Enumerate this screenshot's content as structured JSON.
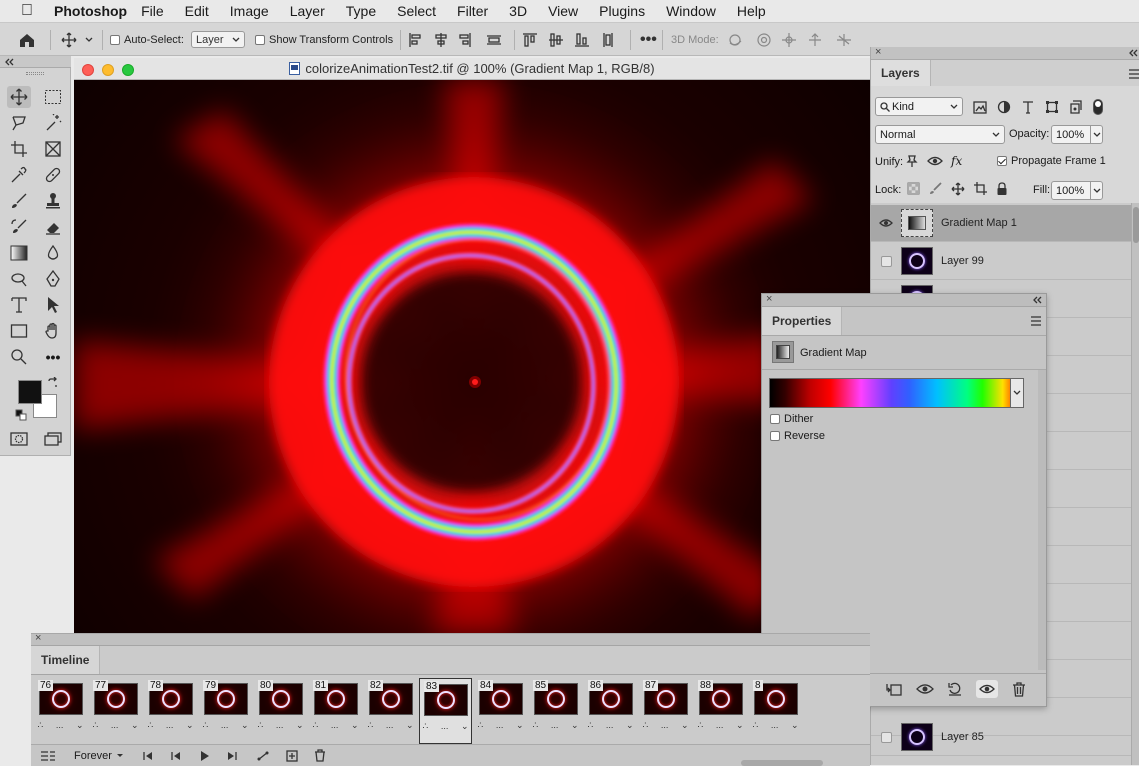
{
  "menubar": {
    "app_name": "Photoshop",
    "items": [
      "File",
      "Edit",
      "Image",
      "Layer",
      "Type",
      "Select",
      "Filter",
      "3D",
      "View",
      "Plugins",
      "Window",
      "Help"
    ]
  },
  "options_bar": {
    "auto_select_label": "Auto-Select:",
    "auto_select_checked": false,
    "auto_select_target": "Layer",
    "show_transform_label": "Show Transform Controls",
    "show_transform_checked": false,
    "mode_3d_label": "3D Mode:"
  },
  "document": {
    "title": "colorizeAnimationTest2.tif @ 100% (Gradient Map 1, RGB/8)"
  },
  "layers_panel": {
    "tab_label": "Layers",
    "filter_kind": "Kind",
    "blend_mode": "Normal",
    "opacity_label": "Opacity:",
    "opacity_value": "100%",
    "unify_label": "Unify:",
    "propagate_label": "Propagate Frame 1",
    "propagate_checked": true,
    "lock_label": "Lock:",
    "fill_label": "Fill:",
    "fill_value": "100%",
    "layers": [
      {
        "name": "Gradient Map 1",
        "visible": true,
        "selected": true
      },
      {
        "name": "Layer 99",
        "visible": false,
        "selected": false
      },
      {
        "name": "Layer 85",
        "visible": false,
        "selected": false
      }
    ]
  },
  "properties_panel": {
    "tab_label": "Properties",
    "adjustment_name": "Gradient Map",
    "dither_label": "Dither",
    "dither_checked": false,
    "reverse_label": "Reverse",
    "reverse_checked": false,
    "gradient_colors": [
      "#000000",
      "#ff0000",
      "#ff40ff",
      "#4040ff",
      "#00ffff",
      "#00ff00",
      "#ffff00",
      "#ff0000"
    ]
  },
  "timeline": {
    "tab_label": "Timeline",
    "loop_value": "Forever",
    "current_frame": 83,
    "frames": [
      {
        "num": "76",
        "delay": "..."
      },
      {
        "num": "77",
        "delay": "..."
      },
      {
        "num": "78",
        "delay": "..."
      },
      {
        "num": "79",
        "delay": "..."
      },
      {
        "num": "80",
        "delay": "..."
      },
      {
        "num": "81",
        "delay": "..."
      },
      {
        "num": "82",
        "delay": "..."
      },
      {
        "num": "83",
        "delay": "..."
      },
      {
        "num": "84",
        "delay": "..."
      },
      {
        "num": "85",
        "delay": "..."
      },
      {
        "num": "86",
        "delay": "..."
      },
      {
        "num": "87",
        "delay": "..."
      },
      {
        "num": "88",
        "delay": "..."
      },
      {
        "num": "8",
        "delay": "..."
      }
    ]
  }
}
